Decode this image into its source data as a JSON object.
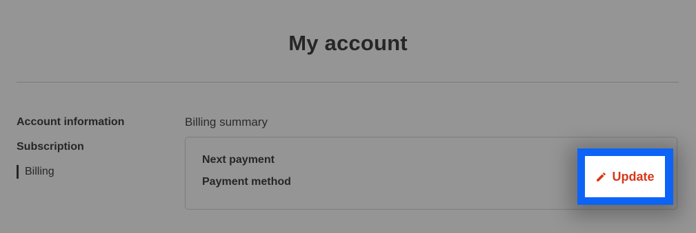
{
  "header": {
    "title": "My account"
  },
  "sidebar": {
    "items": [
      {
        "label": "Account information",
        "active": false
      },
      {
        "label": "Subscription",
        "active": false
      },
      {
        "label": "Billing",
        "active": true
      }
    ]
  },
  "billing": {
    "section_title": "Billing summary",
    "rows": [
      {
        "label": "Next payment"
      },
      {
        "label": "Payment method"
      }
    ],
    "update_button": {
      "label": "Update",
      "icon": "pencil-icon"
    }
  },
  "colors": {
    "overlay_background": "#959595",
    "accent_red": "#d9361a",
    "highlight_blue": "#0d63f6"
  }
}
